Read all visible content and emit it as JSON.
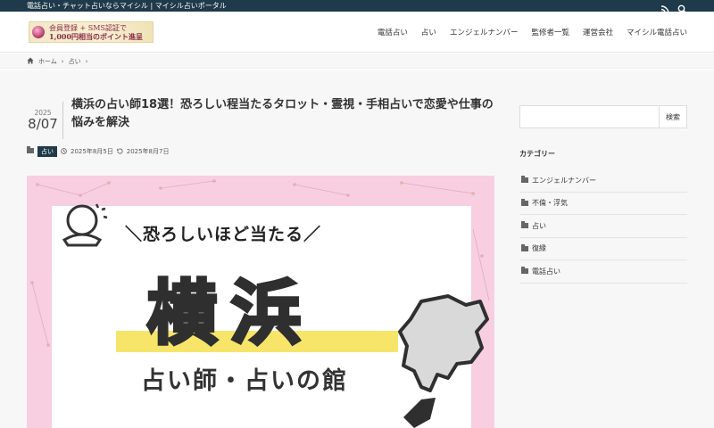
{
  "topbar": {
    "tagline": "電話占い・チャット占いならマイシル | マイシル占いポータル",
    "icons": [
      "rss-icon",
      "search-icon"
    ]
  },
  "logo": {
    "line1": "会員登録 + SMS認証で",
    "line2": "1,000円相当のポイント進呈"
  },
  "nav": {
    "items": [
      "電話占い",
      "占い",
      "エンジェルナンバー",
      "監修者一覧",
      "運営会社",
      "マイシル電話占い"
    ]
  },
  "breadcrumb": {
    "home": "ホーム",
    "current": "占い"
  },
  "post": {
    "year": "2025",
    "day": "8/07",
    "title": "横浜の占い師18選！恐ろしい程当たるタロット・霊視・手相占いで恋愛や仕事の悩みを解決",
    "category": "占い",
    "published": "2025年8月5日",
    "updated": "2025年8月7日"
  },
  "hero": {
    "subtitle": "＼恐ろしいほど当たる／",
    "big": "横浜",
    "caption": "占い師・占いの館",
    "colors": {
      "background": "#f7cfe0",
      "band": "#f7e56a",
      "map": "#d9d9d9"
    }
  },
  "sidebar": {
    "search_placeholder": "",
    "search_button": "検索",
    "categories_heading": "カテゴリー",
    "categories": [
      "エンジェルナンバー",
      "不倫・浮気",
      "占い",
      "復縁",
      "電話占い"
    ]
  },
  "colors": {
    "primary": "#1f3a4a"
  }
}
